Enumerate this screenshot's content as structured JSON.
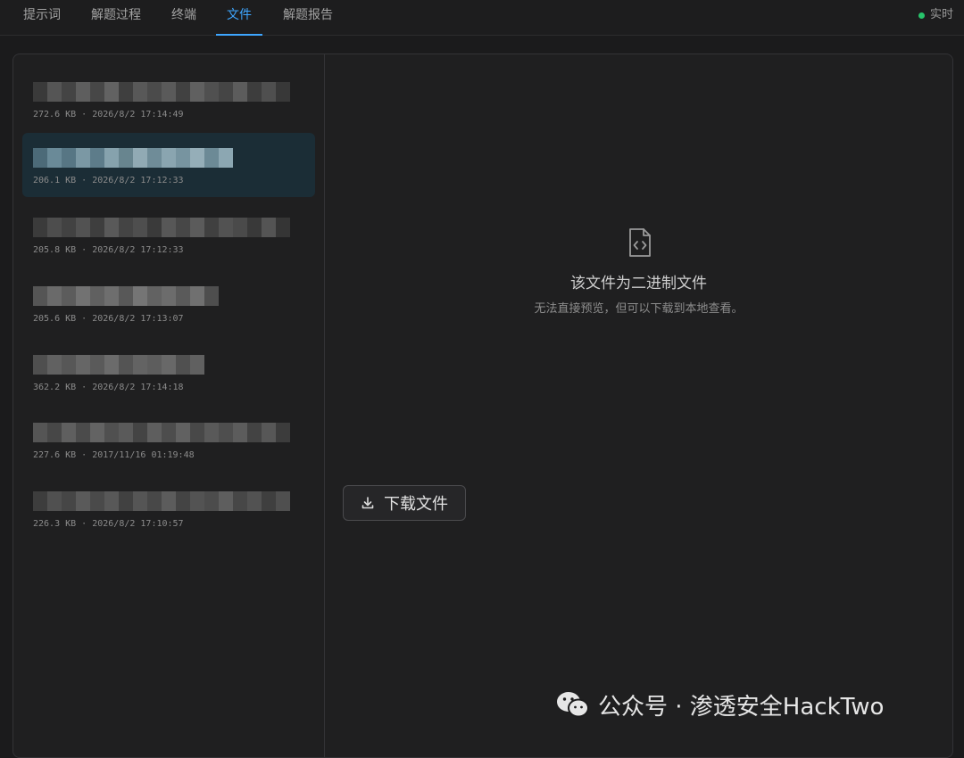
{
  "tabs": [
    {
      "label": "提示词",
      "active": false
    },
    {
      "label": "解题过程",
      "active": false
    },
    {
      "label": "终端",
      "active": false
    },
    {
      "label": "文件",
      "active": true
    },
    {
      "label": "解题报告",
      "active": false
    }
  ],
  "status": {
    "label": "实时",
    "color": "#27c46b"
  },
  "files": [
    {
      "name": "",
      "meta": "272.6 KB · 2026/8/2 17:14:49",
      "selected": false
    },
    {
      "name": "",
      "meta": "206.1 KB · 2026/8/2 17:12:33",
      "selected": true
    },
    {
      "name": "",
      "meta": "205.8 KB · 2026/8/2 17:12:33",
      "selected": false
    },
    {
      "name": "",
      "meta": "205.6 KB · 2026/8/2 17:13:07",
      "selected": false
    },
    {
      "name": "",
      "meta": "362.2 KB · 2026/8/2 17:14:18",
      "selected": false
    },
    {
      "name": "",
      "meta": "227.6 KB · 2017/11/16 01:19:48",
      "selected": false
    },
    {
      "name": "",
      "meta": "226.3 KB · 2026/8/2 17:10:57",
      "selected": false
    }
  ],
  "preview": {
    "icon": "file-code-icon",
    "title": "该文件为二进制文件",
    "subtitle": "无法直接预览，但可以下载到本地查看。",
    "download_label": "下载文件"
  },
  "watermark": {
    "text": "公众号 · 渗透安全HackTwo",
    "icon": "wechat-icon"
  },
  "colors": {
    "accent": "#3ea6ff",
    "selected_bg": "#1b2d36",
    "background": "#1b1b1c"
  }
}
